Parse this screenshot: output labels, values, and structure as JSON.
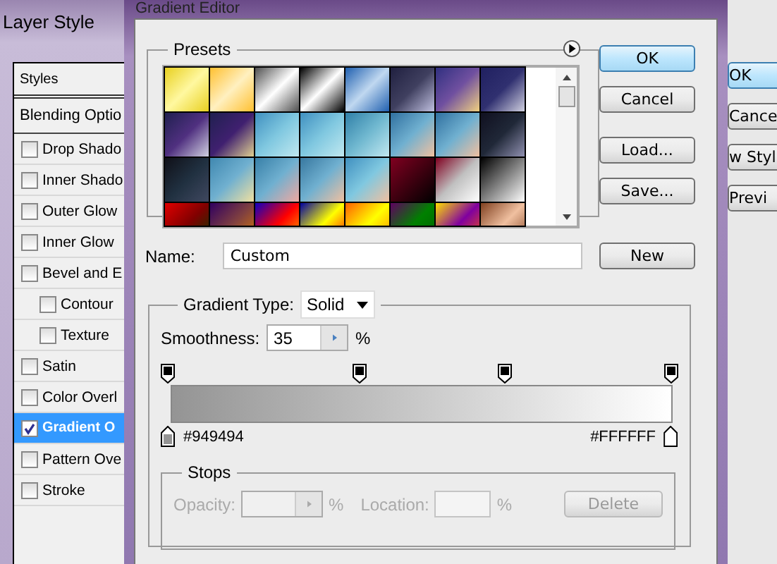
{
  "layer_style": {
    "title": "Layer Style",
    "styles_header": "Styles",
    "blending_options": "Blending Optio",
    "items": [
      {
        "label": "Drop Shado",
        "checked": false,
        "selected": false
      },
      {
        "label": "Inner Shado",
        "checked": false,
        "selected": false
      },
      {
        "label": "Outer Glow",
        "checked": false,
        "selected": false
      },
      {
        "label": "Inner Glow",
        "checked": false,
        "selected": false
      },
      {
        "label": "Bevel and E",
        "checked": false,
        "selected": false,
        "children": [
          {
            "label": "Contour",
            "checked": false,
            "selected": false
          },
          {
            "label": "Texture",
            "checked": false,
            "selected": false
          }
        ]
      },
      {
        "label": "Satin",
        "checked": false,
        "selected": false
      },
      {
        "label": "Color Overl",
        "checked": false,
        "selected": false
      },
      {
        "label": "Gradient O",
        "checked": true,
        "selected": true
      },
      {
        "label": "Pattern Ove",
        "checked": false,
        "selected": false
      },
      {
        "label": "Stroke",
        "checked": false,
        "selected": false
      }
    ],
    "right_buttons": [
      {
        "label": "OK",
        "default": true
      },
      {
        "label": "Cance",
        "default": false
      },
      {
        "label": "w Styl",
        "default": false
      },
      {
        "label": "Previ",
        "default": false
      }
    ]
  },
  "gradient_editor": {
    "title": "Gradient Editor",
    "presets_label": "Presets",
    "buttons": [
      {
        "label": "OK",
        "default": true
      },
      {
        "label": "Cancel",
        "default": false
      },
      {
        "label": "Load...",
        "default": false
      },
      {
        "label": "Save...",
        "default": false
      }
    ],
    "name_label": "Name:",
    "name_value": "Custom",
    "new_button": "New",
    "gradient_type_label": "Gradient Type:",
    "gradient_type_value": "Solid",
    "smoothness_label": "Smoothness:",
    "smoothness_value": "35",
    "smoothness_unit": "%",
    "opacity_stops": [
      {
        "level": 0
      },
      {
        "level": 0.38
      },
      {
        "level": 0.67
      },
      {
        "level": 1
      }
    ],
    "color_stops": [
      {
        "level": 0,
        "color": "#949494"
      },
      {
        "level": 1,
        "color": "#FFFFFF"
      }
    ],
    "stops": {
      "label": "Stops",
      "opacity_label": "Opacity:",
      "opacity_unit": "%",
      "location_label": "Location:",
      "location_unit": "%",
      "delete_button": "Delete",
      "disabled": true
    }
  }
}
